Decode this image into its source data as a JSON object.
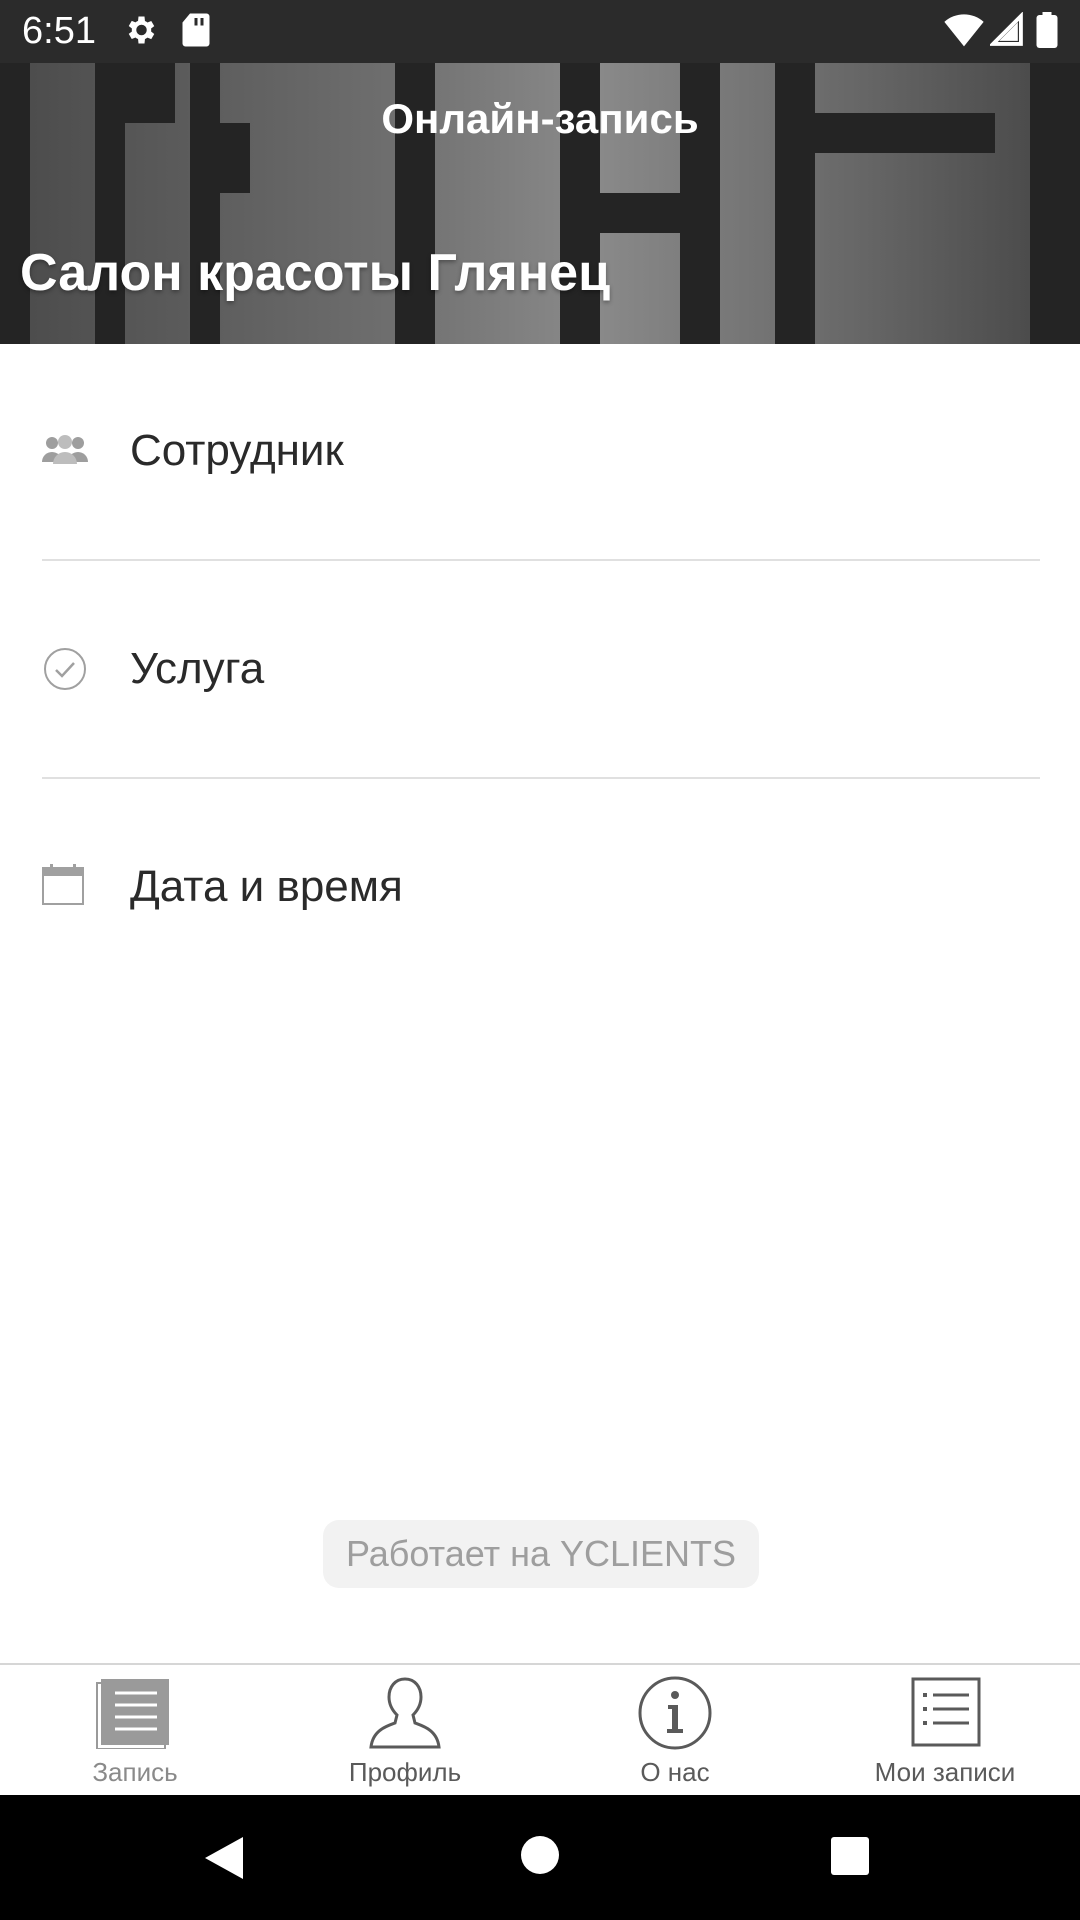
{
  "status_bar": {
    "time": "6:51",
    "icons": [
      "gear-icon",
      "sd-card-icon",
      "wifi-icon",
      "signal-icon",
      "battery-icon"
    ]
  },
  "header": {
    "title": "Онлайн-запись",
    "salon_name": "Салон красоты Глянец"
  },
  "menu": {
    "items": [
      {
        "label": "Сотрудник",
        "icon": "staff-icon"
      },
      {
        "label": "Услуга",
        "icon": "check-circle-icon"
      },
      {
        "label": "Дата и время",
        "icon": "calendar-icon"
      }
    ]
  },
  "footer": {
    "powered_by": "Работает на YCLIENTS"
  },
  "bottom_nav": {
    "items": [
      {
        "label": "Запись",
        "icon": "booking-icon",
        "active": true
      },
      {
        "label": "Профиль",
        "icon": "profile-icon",
        "active": false
      },
      {
        "label": "О нас",
        "icon": "info-icon",
        "active": false
      },
      {
        "label": "Мои записи",
        "icon": "list-icon",
        "active": false
      }
    ]
  },
  "colors": {
    "status_bar": "#2b2b2b",
    "text_primary": "#2a2a2a",
    "text_muted": "#9e9e9e",
    "divider": "#e0e0e0"
  }
}
